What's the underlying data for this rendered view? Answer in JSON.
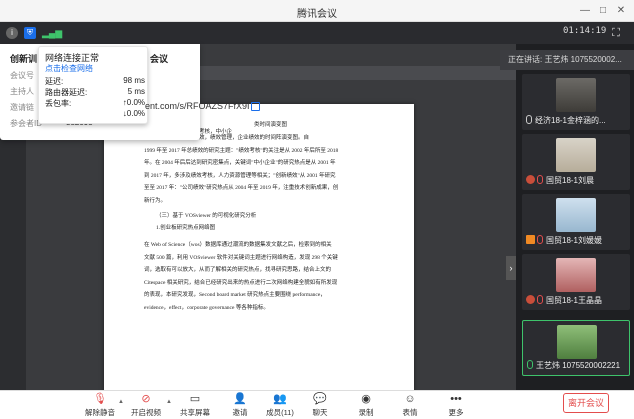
{
  "window": {
    "title": "腾讯会议"
  },
  "status": {
    "clock": "01:14:19"
  },
  "meeting_info": {
    "heading_prefix": "创新训",
    "heading_suffix": "会议",
    "labels": [
      "会议号",
      "主持人",
      "邀请链",
      "参会者ID"
    ],
    "id_fragment": "382095",
    "invite_url": "ent.com/s/RFOAZS7FfX9I"
  },
  "network": {
    "title": "网络连接正常",
    "check_link": "点击检查网络",
    "rows": [
      {
        "label": "延迟:",
        "value": "98 ms"
      },
      {
        "label": "路由器延迟:",
        "value": "5 ms"
      },
      {
        "label": "丢包率:",
        "value": "↑0.0%"
      },
      {
        "label": "",
        "value": "↓0.0%"
      }
    ]
  },
  "document": {
    "lines": [
      "类时间演变图",
      "……是企业绩效，绩效考核，中小企",
      "业，创新绩效，公司绩效，绩效管理，企业绩效的时间阵演变图。自",
      "1999 年至 2017 年总绩效的研究主题：\"绩效考核\"的关注是从 2002 年后所至 2018",
      "年。在 2004 年后后达到研究密集点，关键词\"中小企业\"的研究热点是从 2001 年",
      "到 2017 年，多涉及绩效考核，人力资源管理等相关；\"创新绩效\"从 2001 年研究",
      "至至 2017 年：\"公司绩效\"研究热点从 2004 年至 2019 年，注重技术创新成果，创",
      "新行为。",
      "（三）基于 VOSviewer 的可视化研究分析",
      "1.创业板研究热点网络图",
      "在 Web of Science（wos）数据库通过潮流的数据集发文献之后，检索到的相关",
      "文献 500 篇，利用 VOSviewer 软件对关键词主题进行网络构造，发现 298 个关键",
      "词，选取有可以放大，从而了解相关的研究热点，找寻研究思路，结合上文的",
      "Citespace 相关研究，结合已经研究出来的热点进行二次网络构建全貌如有所发现",
      "的表现，本研究发现，Second board market 研究热点主要围绕 performance，",
      "evidence，effect，corporate governance 等各种指标。"
    ]
  },
  "speaking": {
    "text": "正在讲话: 王艺炜 1075520002..."
  },
  "participants": [
    {
      "name": "经济18-1金梓涵的..."
    },
    {
      "name": "国贸18-1刘晨"
    },
    {
      "name": "国贸18-1刘媛媛"
    },
    {
      "name": "国贸18-1王晶晶"
    },
    {
      "name": "王艺炜 1075520002221"
    }
  ],
  "toolbar": {
    "mute": "解除静音",
    "video": "开启视频",
    "share": "共享屏幕",
    "invite": "邀请",
    "members": "成员(11)",
    "chat": "聊天",
    "record": "录制",
    "emoji": "表情",
    "more": "更多",
    "leave": "离开会议"
  },
  "colors": {
    "accent": "#1a6eea",
    "danger": "#e34d4d",
    "active_border": "#3ec36b"
  }
}
